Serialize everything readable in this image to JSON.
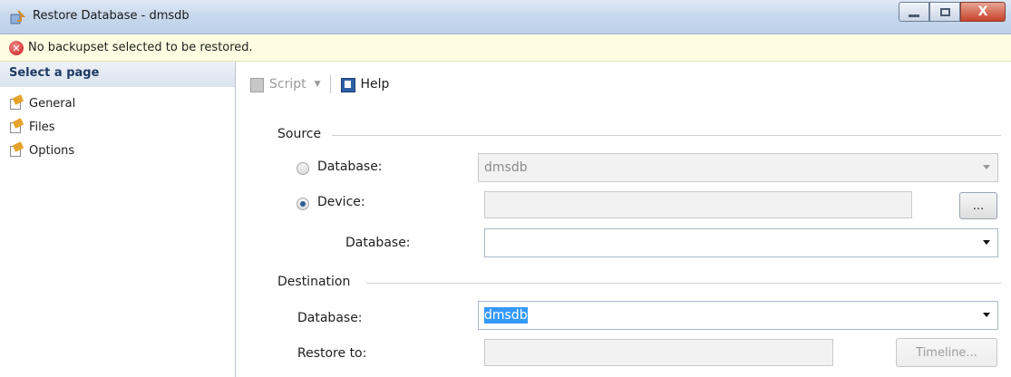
{
  "window": {
    "title": "Restore Database - dmsdb",
    "buttons": {
      "minimize": "–",
      "maximize": "□",
      "close": "X"
    }
  },
  "info_bar": {
    "message": "No backupset selected to be restored."
  },
  "sidebar": {
    "header": "Select a page",
    "items": [
      {
        "label": "General"
      },
      {
        "label": "Files"
      },
      {
        "label": "Options"
      }
    ]
  },
  "toolbar": {
    "script_label": "Script",
    "help_label": "Help"
  },
  "source": {
    "group_label": "Source",
    "database_radio_label": "Database:",
    "database_value": "dmsdb",
    "device_radio_label": "Device:",
    "device_value": "",
    "browse_label": "...",
    "device_database_label": "Database:",
    "device_database_value": ""
  },
  "destination": {
    "group_label": "Destination",
    "database_label": "Database:",
    "database_value": "dmsdb",
    "restore_to_label": "Restore to:",
    "restore_to_value": "",
    "timeline_label": "Timeline..."
  }
}
